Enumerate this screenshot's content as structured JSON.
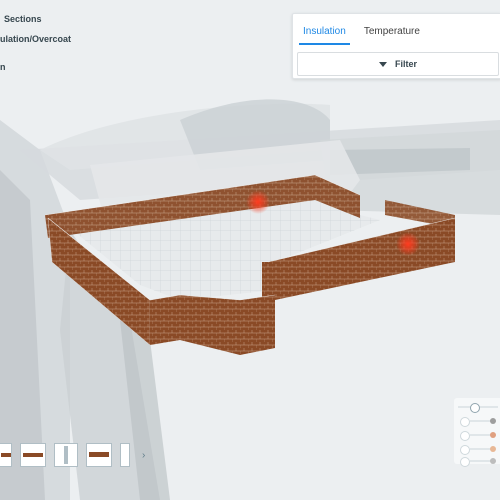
{
  "overlay": {
    "line1": "Sections",
    "line2": "ulation/Overcoat",
    "line3": "n"
  },
  "panel": {
    "tabs": [
      {
        "label": "Insulation",
        "active": true
      },
      {
        "label": "Temperature",
        "active": false
      }
    ],
    "filter_label": "Filter"
  },
  "thumbnails": {
    "next_glyph": "›"
  },
  "colors": {
    "accent": "#1e88e5",
    "brick": "#8a4a26",
    "hotspot": "#ff2a10",
    "legend_dots": [
      "#9e9e9e",
      "#e0a080",
      "#e8b896",
      "#bdbdbd"
    ]
  }
}
